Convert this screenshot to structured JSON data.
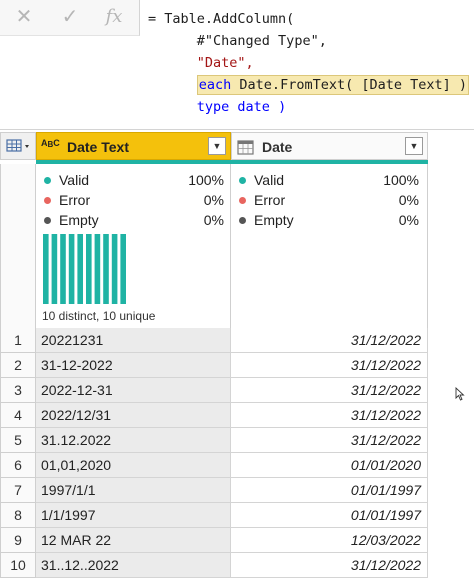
{
  "formula_bar": {
    "cancel_icon": "x-icon",
    "confirm_icon": "check-icon",
    "fx_label": "fx",
    "lines": {
      "l1": "= Table.AddColumn(",
      "l2": "#\"Changed Type\",",
      "l3": "\"Date\",",
      "l4_kw": "each",
      "l4_rest": " Date.FromText( [Date Text] )",
      "l4_tail": " ,",
      "l5_kw": "type",
      "l5_rest": " date )"
    }
  },
  "columns": [
    {
      "name": "Date Text",
      "type_icon": "ABC",
      "color": "#f4c10c"
    },
    {
      "name": "Date",
      "type_icon": "calendar-icon"
    }
  ],
  "profile": {
    "col1": {
      "valid_label": "Valid",
      "valid_pct": "100%",
      "error_label": "Error",
      "error_pct": "0%",
      "empty_label": "Empty",
      "empty_pct": "0%",
      "distribution": [
        1,
        1,
        1,
        1,
        1,
        1,
        1,
        1,
        1,
        1
      ],
      "distinct_text": "10 distinct, 10 unique"
    },
    "col2": {
      "valid_label": "Valid",
      "valid_pct": "100%",
      "error_label": "Error",
      "error_pct": "0%",
      "empty_label": "Empty",
      "empty_pct": "0%"
    },
    "colors": {
      "valid": "#1fb3a4",
      "error": "#e8655f",
      "empty": "#555555"
    }
  },
  "rows": [
    {
      "index": "1",
      "date_text": "20221231",
      "date": "31/12/2022"
    },
    {
      "index": "2",
      "date_text": "31-12-2022",
      "date": "31/12/2022"
    },
    {
      "index": "3",
      "date_text": "2022-12-31",
      "date": "31/12/2022"
    },
    {
      "index": "4",
      "date_text": "2022/12/31",
      "date": "31/12/2022"
    },
    {
      "index": "5",
      "date_text": "31.12.2022",
      "date": "31/12/2022"
    },
    {
      "index": "6",
      "date_text": "01,01,2020",
      "date": "01/01/2020"
    },
    {
      "index": "7",
      "date_text": "1997/1/1",
      "date": "01/01/1997"
    },
    {
      "index": "8",
      "date_text": "1/1/1997",
      "date": "01/01/1997"
    },
    {
      "index": "9",
      "date_text": "12 MAR 22",
      "date": "12/03/2022"
    },
    {
      "index": "10",
      "date_text": "31..12..2022",
      "date": "31/12/2022"
    }
  ]
}
